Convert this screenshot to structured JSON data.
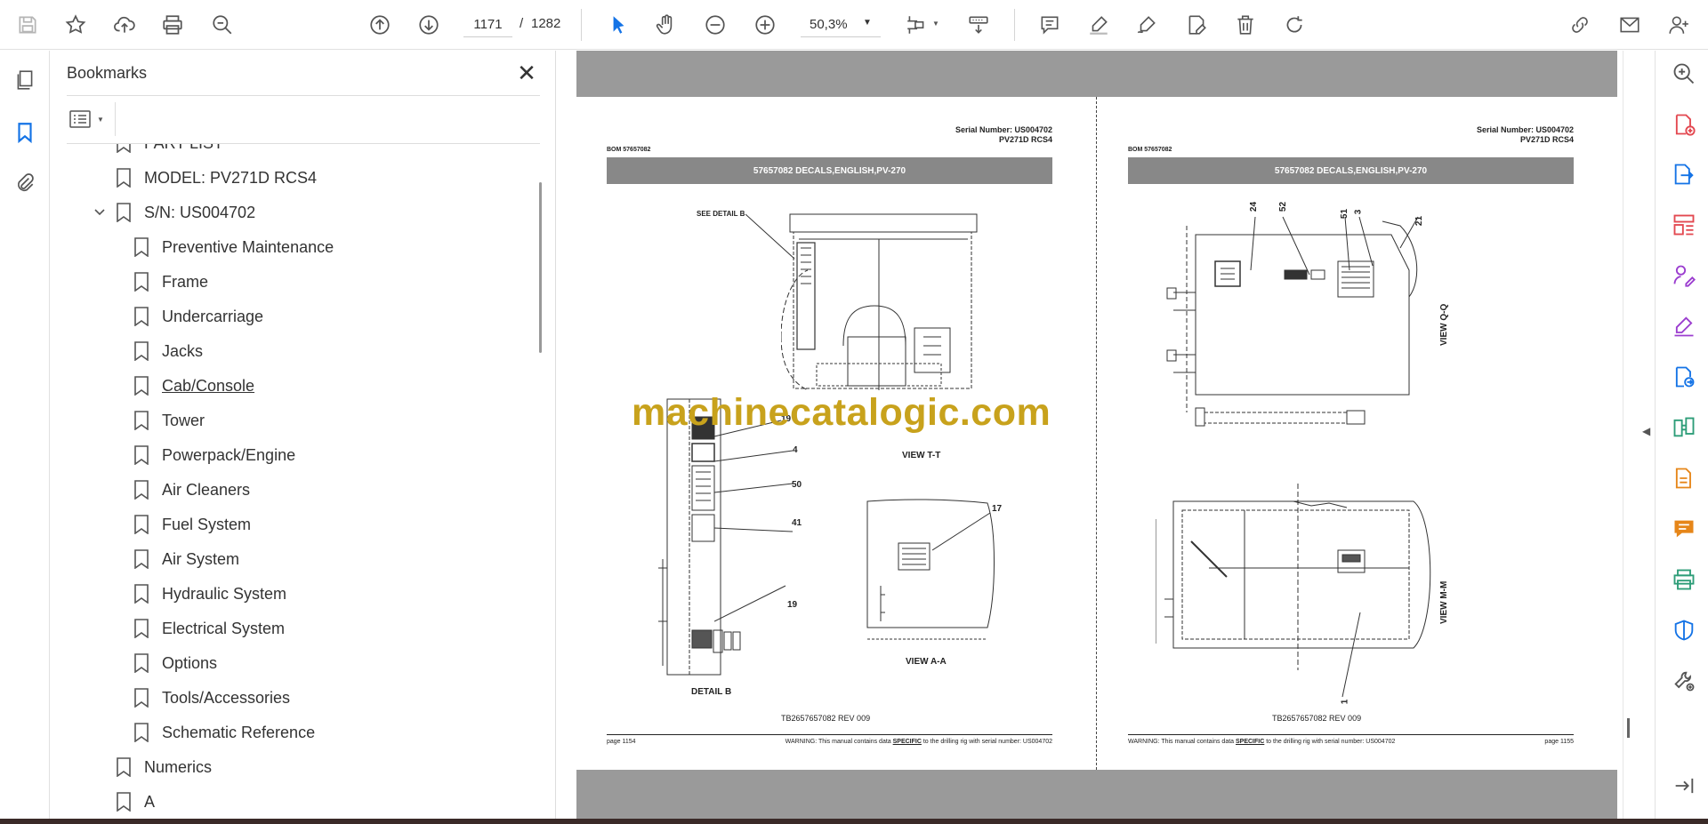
{
  "toolbar": {
    "current_page": "1171",
    "page_separator": "/",
    "total_pages": "1282",
    "zoom": "50,3%"
  },
  "bookmarks": {
    "title": "Bookmarks",
    "items": [
      {
        "label": "PART LIST",
        "level": 1
      },
      {
        "label": "MODEL: PV271D RCS4",
        "level": 1
      },
      {
        "label": "S/N: US004702",
        "level": 1,
        "expanded": true
      },
      {
        "label": "Preventive Maintenance",
        "level": 2
      },
      {
        "label": "Frame",
        "level": 2
      },
      {
        "label": "Undercarriage",
        "level": 2
      },
      {
        "label": "Jacks",
        "level": 2
      },
      {
        "label": "Cab/Console",
        "level": 2,
        "hovered": true
      },
      {
        "label": "Tower",
        "level": 2
      },
      {
        "label": "Powerpack/Engine",
        "level": 2
      },
      {
        "label": "Air Cleaners",
        "level": 2
      },
      {
        "label": "Fuel System",
        "level": 2
      },
      {
        "label": "Air System",
        "level": 2
      },
      {
        "label": "Hydraulic System",
        "level": 2
      },
      {
        "label": "Electrical System",
        "level": 2
      },
      {
        "label": "Options",
        "level": 2
      },
      {
        "label": "Tools/Accessories",
        "level": 2
      },
      {
        "label": "Schematic Reference",
        "level": 2
      },
      {
        "label": "Numerics",
        "level": 1
      },
      {
        "label": "A",
        "level": 1
      }
    ]
  },
  "pages": {
    "left": {
      "serial_line1": "Serial Number: US004702",
      "serial_line2": "PV271D RCS4",
      "bom": "BOM 57657082",
      "title": "57657082 DECALS,ENGLISH,PV-270",
      "see_detail": "SEE DETAIL B",
      "view_tt": "VIEW T-T",
      "view_aa": "VIEW A-A",
      "detail_b": "DETAIL B",
      "callouts": [
        "19",
        "4",
        "50",
        "41",
        "19",
        "17"
      ],
      "tb_ref": "TB2657657082 REV 009",
      "page_no": "page 1154",
      "warning_pre": "WARNING:  This manual contains data ",
      "warning_em": "SPECIFIC",
      "warning_post": " to the drilling rig with serial number: US004702"
    },
    "right": {
      "serial_line1": "Serial Number: US004702",
      "serial_line2": "PV271D RCS4",
      "bom": "BOM 57657082",
      "title": "57657082 DECALS,ENGLISH,PV-270",
      "view_qq": "VIEW Q-Q",
      "view_mm": "VIEW M-M",
      "callouts": [
        "24",
        "52",
        "51",
        "3",
        "21",
        "1"
      ],
      "tb_ref": "TB2657657082 REV 009",
      "page_no": "page 1155",
      "warning_pre": "WARNING:  This manual contains data ",
      "warning_em": "SPECIFIC",
      "warning_post": " to the drilling rig with serial number: US004702"
    }
  },
  "watermark": "machinecatalogic.com",
  "colors": {
    "accent_blue": "#1473e6",
    "watermark_gold": "#c8a21c",
    "page_gray": "#9a9a9a",
    "title_bar_gray": "#888888"
  }
}
